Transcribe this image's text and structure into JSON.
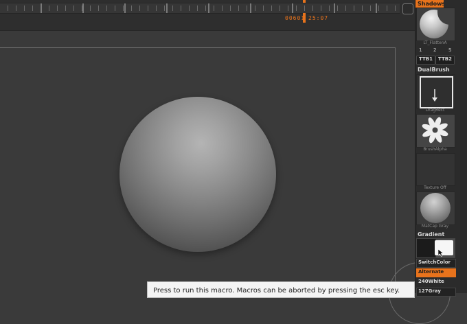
{
  "timeline": {
    "frame_readout": "00601",
    "time_readout": "25:07"
  },
  "status": {
    "message": "Press to run this macro. Macros can be aborted by pressing the esc key."
  },
  "tray": {
    "shadows_label": "Shadows",
    "brush_caption": "LT_FlattenA",
    "numbers": [
      "1",
      "2",
      "S"
    ],
    "ttb1": "TTB1",
    "ttb2": "TTB2",
    "dualbrush_label": "DualBrush",
    "stroke_caption": "DragRect",
    "alpha_caption": "BrushAlpha",
    "texture_caption": "Texture Off",
    "matcap_caption": "MatCap Gray",
    "gradient_label": "Gradient",
    "switchcolor": "SwitchColor",
    "alternate": "Alternate",
    "white_value": "240White",
    "gray_value": "127Gray"
  },
  "colors": {
    "accent": "#e8731c",
    "background": "#3a3a3a",
    "tray_background": "#2b2b2b"
  }
}
